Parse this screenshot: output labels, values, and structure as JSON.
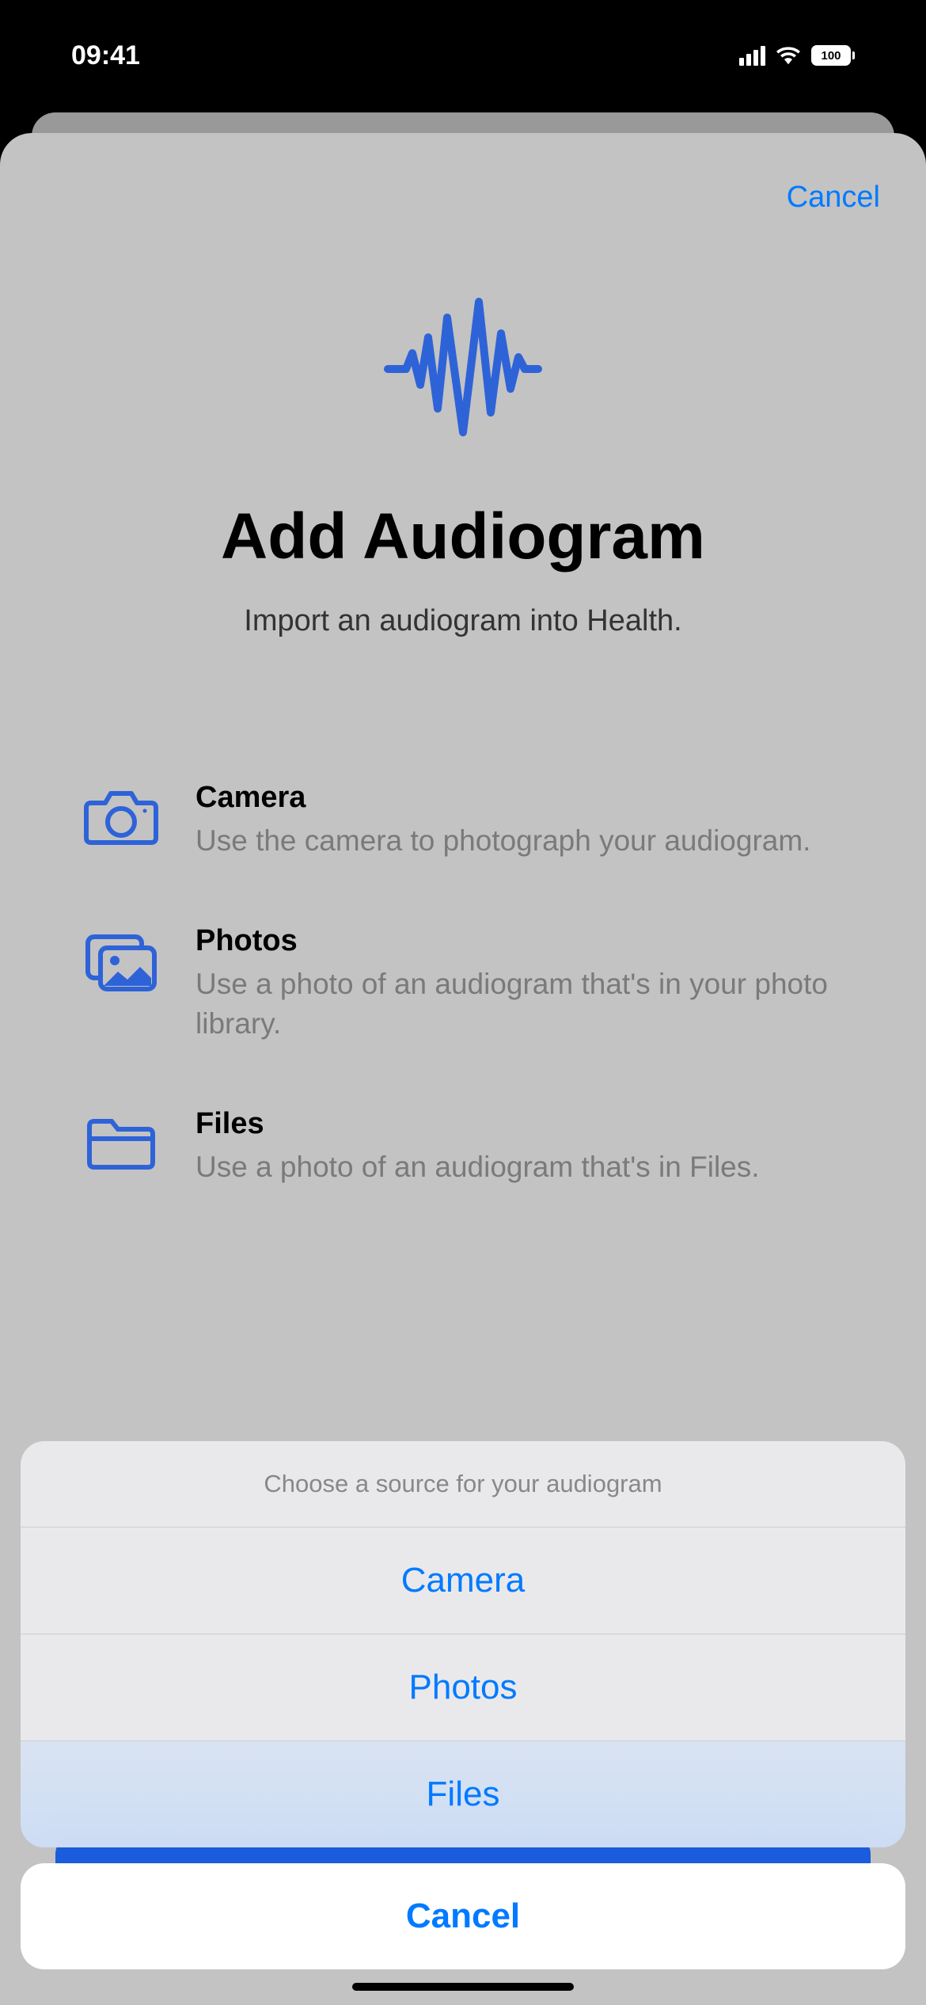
{
  "statusBar": {
    "time": "09:41",
    "battery": "100"
  },
  "sheet": {
    "cancelLabel": "Cancel",
    "title": "Add Audiogram",
    "subtitle": "Import an audiogram into Health.",
    "options": [
      {
        "title": "Camera",
        "description": "Use the camera to photograph your audiogram."
      },
      {
        "title": "Photos",
        "description": "Use a photo of an audiogram that's in your photo library."
      },
      {
        "title": "Files",
        "description": "Use a photo of an audiogram that's in Files."
      }
    ]
  },
  "actionSheet": {
    "title": "Choose a source for your audiogram",
    "options": [
      "Camera",
      "Photos",
      "Files"
    ],
    "cancelLabel": "Cancel"
  }
}
